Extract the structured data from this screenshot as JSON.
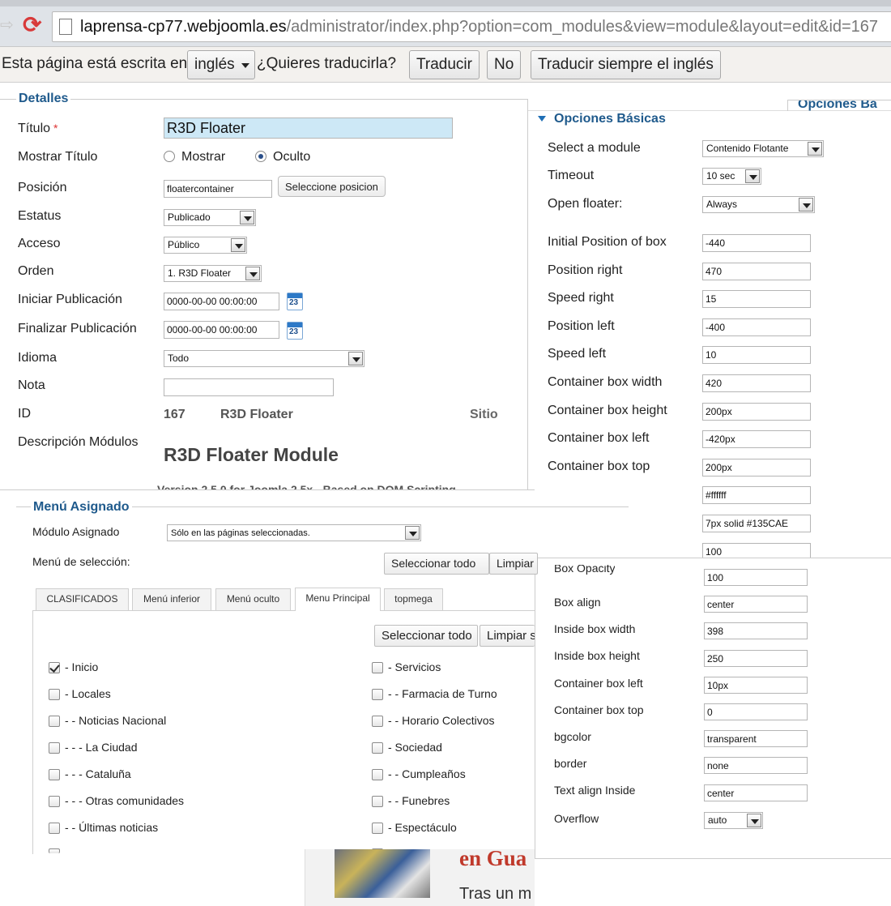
{
  "browser": {
    "url_host": "laprensa-cp77.webjoomla.es",
    "url_path": "/administrator/index.php?option=com_modules&view=module&layout=edit&id=167"
  },
  "translate_bar": {
    "prefix": "Esta página está escrita en",
    "language": "inglés",
    "question": "¿Quieres traducirla?",
    "translate_button": "Traducir",
    "no_button": "No",
    "always_button": "Traducir siempre el inglés"
  },
  "details": {
    "legend": "Detalles",
    "title_label": "Título",
    "required_mark": "*",
    "title_value": "R3D Floater",
    "show_title_label": "Mostrar Título",
    "show_option": "Mostrar",
    "hide_option": "Oculto",
    "position_label": "Posición",
    "position_value": "floatercontainer",
    "select_position_button": "Seleccione posicion",
    "status_label": "Estatus",
    "status_value": "Publicado",
    "access_label": "Acceso",
    "access_value": "Público",
    "order_label": "Orden",
    "order_value": "1. R3D Floater",
    "start_label": "Iniciar Publicación",
    "start_value": "0000-00-00 00:00:00",
    "end_label": "Finalizar Publicación",
    "end_value": "0000-00-00 00:00:00",
    "calendar_day": "23",
    "language_label": "Idioma",
    "language_value": "Todo",
    "note_label": "Nota",
    "note_value": "",
    "id_label": "ID",
    "id_value": "167",
    "id_name": "R3D Floater",
    "site_label": "Sitio",
    "desc_label": "Descripción Módulos",
    "desc_title": "R3D Floater Module",
    "desc_partial": "Version 2.5.0 for Joomla 2.5x - Based on DOM Scripting"
  },
  "basic_options": {
    "title": "Opciones Básicas",
    "other_title": "Opciones Ba",
    "select_module_label": "Select a module",
    "select_module_value": "Contenido Flotante",
    "timeout_label": "Timeout",
    "timeout_value": "10 sec",
    "open_floater_label": "Open floater:",
    "open_floater_value": "Always",
    "rows": [
      {
        "label": "Initial Position of box",
        "value": "-440"
      },
      {
        "label": "Position right",
        "value": "470"
      },
      {
        "label": "Speed right",
        "value": "15"
      },
      {
        "label": "Position left",
        "value": "-400"
      },
      {
        "label": "Speed left",
        "value": "10"
      },
      {
        "label": "Container box width",
        "value": "420"
      },
      {
        "label": "Container box height",
        "value": "200px"
      },
      {
        "label": "Container box left",
        "value": "-420px"
      },
      {
        "label": "Container box top",
        "value": "200px"
      },
      {
        "label": "",
        "value": "#ffffff"
      },
      {
        "label": "",
        "value": "7px solid #135CAE"
      },
      {
        "label": "",
        "value": "100"
      }
    ]
  },
  "lower_options": {
    "rows": [
      {
        "label": "Box Opacity",
        "value": "100"
      },
      {
        "label": "Box align",
        "value": "center"
      },
      {
        "label": "Inside box width",
        "value": "398"
      },
      {
        "label": "Inside box height",
        "value": "250"
      },
      {
        "label": "Container box left",
        "value": "10px"
      },
      {
        "label": "Container box top",
        "value": "0"
      },
      {
        "label": "bgcolor",
        "value": "transparent"
      },
      {
        "label": "border",
        "value": "none"
      },
      {
        "label": "Text align Inside",
        "value": "center"
      }
    ],
    "overflow_label": "Overflow",
    "overflow_value": "auto"
  },
  "menu": {
    "legend": "Menú Asignado",
    "assigned_label": "Módulo Asignado",
    "assigned_value": "Sólo en las páginas seleccionadas.",
    "selection_label": "Menú de selección:",
    "select_all": "Seleccionar todo",
    "clear": "Limpiar",
    "clear_partial": "Limpiar s",
    "tabs": [
      "CLASIFICADOS",
      "Menú inferior",
      "Menú oculto",
      "Menu Principal",
      "topmega"
    ],
    "left_items": [
      {
        "label": "- Inicio",
        "checked": true
      },
      {
        "label": "- Locales",
        "checked": false
      },
      {
        "label": "- - Noticias Nacional",
        "checked": false
      },
      {
        "label": "- - - La Ciudad",
        "checked": false
      },
      {
        "label": "- - - Cataluña",
        "checked": false
      },
      {
        "label": "- - - Otras comunidades",
        "checked": false
      },
      {
        "label": "- - Últimas noticias",
        "checked": false
      }
    ],
    "right_items": [
      {
        "label": "- Servicios",
        "checked": false
      },
      {
        "label": "- - Farmacia de Turno",
        "checked": false
      },
      {
        "label": "- - Horario Colectivos",
        "checked": false
      },
      {
        "label": "- Sociedad",
        "checked": false
      },
      {
        "label": "- - Cumpleaños",
        "checked": false
      },
      {
        "label": "- - Funebres",
        "checked": false
      },
      {
        "label": "- Espectáculo",
        "checked": false
      }
    ]
  },
  "background_page": {
    "headline_partial": "en Gua",
    "text_partial": "Tras un m"
  },
  "colors": {
    "legend_blue": "#1f5a8c",
    "highlight_input": "#cde8f6"
  }
}
